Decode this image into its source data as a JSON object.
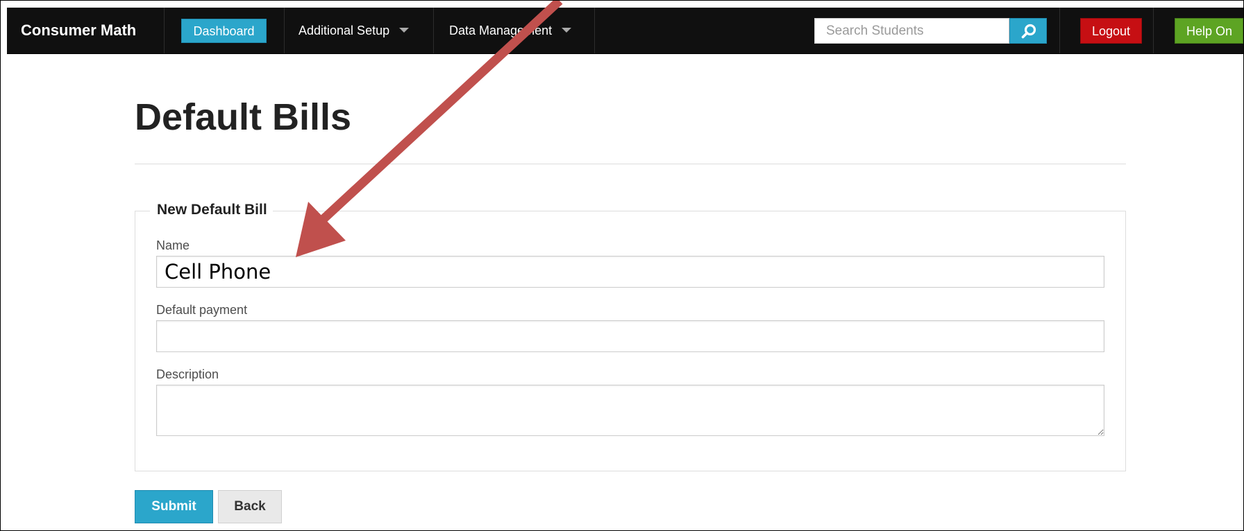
{
  "navbar": {
    "brand": "Consumer Math",
    "dashboard_label": "Dashboard",
    "additional_setup_label": "Additional Setup",
    "data_management_label": "Data Management",
    "search_placeholder": "Search Students",
    "logout_label": "Logout",
    "help_label": "Help On"
  },
  "page": {
    "title": "Default Bills"
  },
  "form": {
    "legend": "New Default Bill",
    "name_label": "Name",
    "name_value": "Cell Phone",
    "default_payment_label": "Default payment",
    "default_payment_value": "",
    "description_label": "Description",
    "description_value": "",
    "submit_label": "Submit",
    "back_label": "Back"
  },
  "colors": {
    "navbar_bg": "#101010",
    "primary": "#2ba6cb",
    "logout": "#c60f13",
    "help": "#5da423",
    "annotation_arrow": "#c0504d"
  },
  "icons": {
    "search": "search-icon",
    "dropdown": "caret-down-icon"
  }
}
